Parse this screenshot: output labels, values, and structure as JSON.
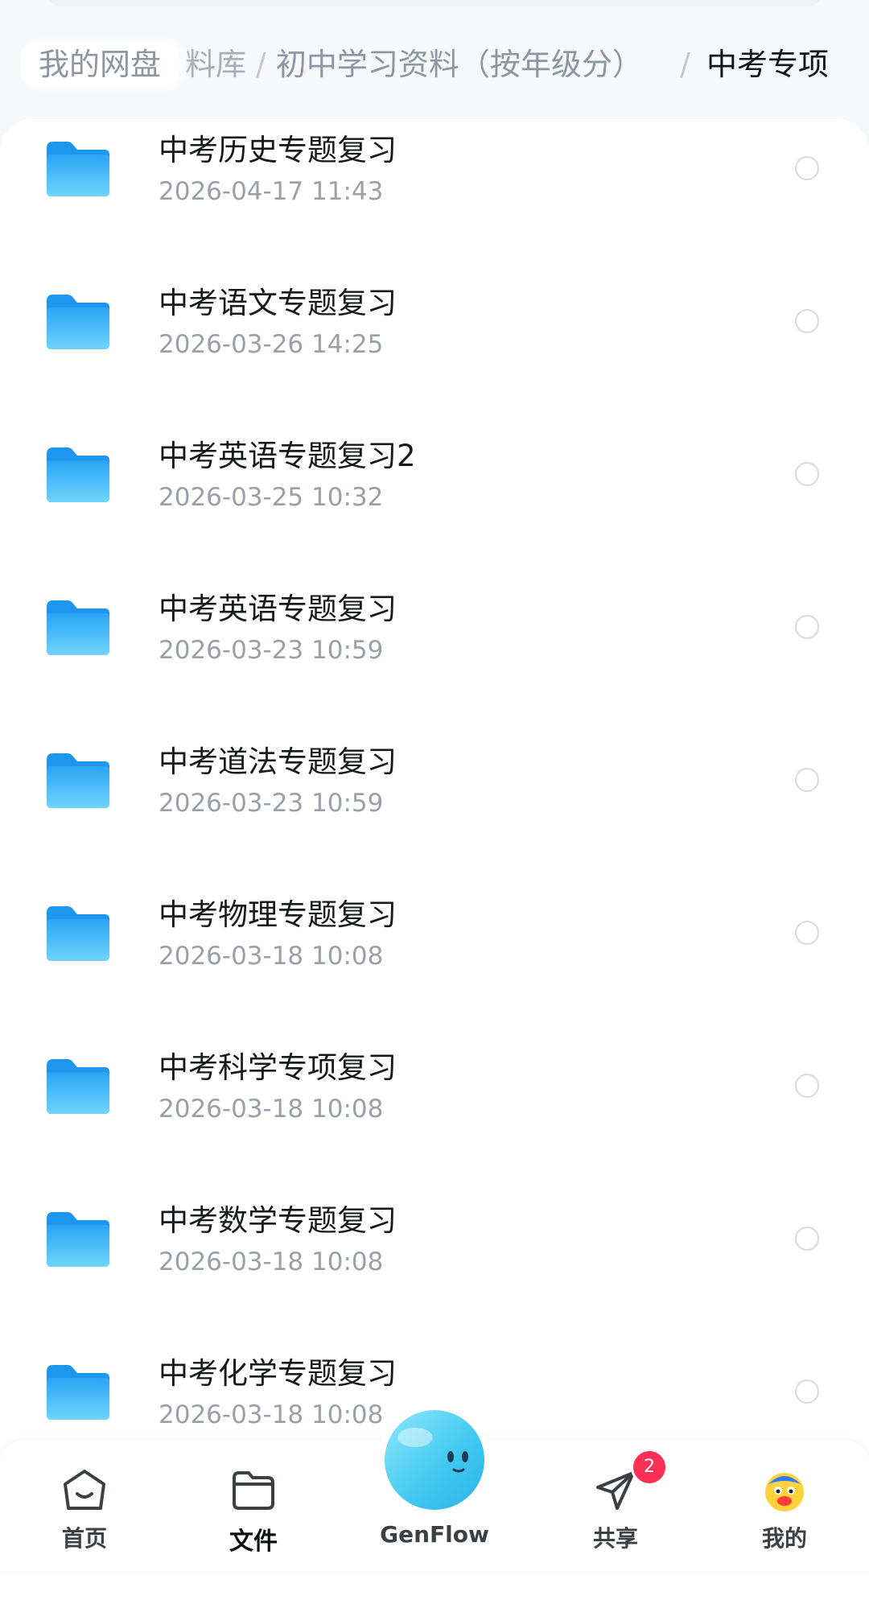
{
  "breadcrumb": {
    "root": "我的网盘",
    "items": [
      "料库",
      "初中学习资料（按年级分）"
    ],
    "separator": "/",
    "current": "中考专项"
  },
  "files": [
    {
      "name": "中考历史专题复习",
      "date": "2026-04-17  11:43",
      "icon": "folder-icon"
    },
    {
      "name": "中考语文专题复习",
      "date": "2026-03-26  14:25",
      "icon": "folder-icon"
    },
    {
      "name": "中考英语专题复习2",
      "date": "2026-03-25  10:32",
      "icon": "folder-icon"
    },
    {
      "name": "中考英语专题复习",
      "date": "2026-03-23  10:59",
      "icon": "folder-icon"
    },
    {
      "name": "中考道法专题复习",
      "date": "2026-03-23  10:59",
      "icon": "folder-icon"
    },
    {
      "name": "中考物理专题复习",
      "date": "2026-03-18  10:08",
      "icon": "folder-icon"
    },
    {
      "name": "中考科学专项复习",
      "date": "2026-03-18  10:08",
      "icon": "folder-icon"
    },
    {
      "name": "中考数学专题复习",
      "date": "2026-03-18  10:08",
      "icon": "folder-icon"
    },
    {
      "name": "中考化学专题复习",
      "date": "2026-03-18  10:08",
      "icon": "folder-icon"
    }
  ],
  "tabbar": {
    "home": {
      "label": "首页",
      "icon": "home-icon"
    },
    "files": {
      "label": "文件",
      "icon": "folder-tab-icon"
    },
    "genflow": {
      "label": "GenFlow",
      "icon": "genflow-mascot-icon"
    },
    "share": {
      "label": "共享",
      "icon": "send-icon",
      "badge": "2"
    },
    "mine": {
      "label": "我的",
      "icon": "avatar-icon"
    }
  },
  "colors": {
    "folder": "#36b4f7",
    "badge": "#ff2f55",
    "accent_text": "#111418",
    "secondary_text": "#9aa0aa"
  }
}
